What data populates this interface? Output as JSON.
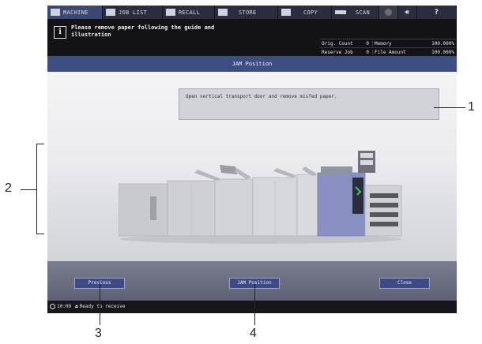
{
  "tabs": {
    "machine": "MACHINE",
    "job_list": "JOB LIST",
    "recall": "RECALL",
    "store": "STORE",
    "copy": "COPY",
    "scan": "SCAN",
    "help": "?"
  },
  "message": {
    "text": "Please remove paper following the guide and illustration"
  },
  "counters": {
    "orig_count_label": "Orig. Count",
    "orig_count_value": "0",
    "memory_label": "Memory",
    "memory_value": "100.000%",
    "reserve_job_label": "Reserve Job",
    "reserve_job_value": "0",
    "file_amount_label": "File Amount",
    "file_amount_value": "100.000%"
  },
  "title": "JAM Position",
  "instruction": "Open vertical transport door and remove misfed paper.",
  "buttons": {
    "previous": "Previous",
    "jam_position": "JAM Position",
    "close": "Close"
  },
  "status": {
    "time": "10:00",
    "text": "Ready to receive"
  },
  "callouts": {
    "c1": "1",
    "c2": "2",
    "c3": "3",
    "c4": "4"
  },
  "icons": {
    "info": "i",
    "speaker": "speaker-icon"
  }
}
